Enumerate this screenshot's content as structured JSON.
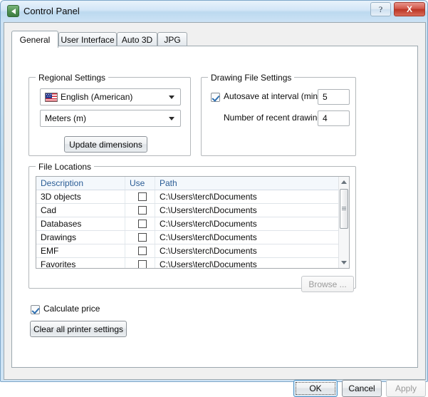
{
  "window": {
    "title": "Control Panel",
    "icon": "back-arrow-icon",
    "help_label": "?",
    "close_label": "X"
  },
  "tabs": [
    {
      "label": "General",
      "active": true
    },
    {
      "label": "User Interface",
      "active": false
    },
    {
      "label": "Auto 3D",
      "active": false
    },
    {
      "label": "JPG",
      "active": false
    }
  ],
  "regional_settings": {
    "group_title": "Regional Settings",
    "language_value": "English (American)",
    "language_flag": "us-flag-icon",
    "units_value": "Meters (m)",
    "update_button_label": "Update dimensions"
  },
  "drawing_file_settings": {
    "group_title": "Drawing File Settings",
    "autosave_label": "Autosave at interval (min)",
    "autosave_checked": true,
    "autosave_value": "5",
    "recent_drawings_label": "Number of recent drawings",
    "recent_drawings_value": "4"
  },
  "file_locations": {
    "group_title": "File Locations",
    "columns": [
      "Description",
      "Use",
      "Path"
    ],
    "rows": [
      {
        "description": "3D objects",
        "use": false,
        "path": "C:\\Users\\tercl\\Documents"
      },
      {
        "description": "Cad",
        "use": false,
        "path": "C:\\Users\\tercl\\Documents"
      },
      {
        "description": "Databases",
        "use": false,
        "path": "C:\\Users\\tercl\\Documents"
      },
      {
        "description": "Drawings",
        "use": false,
        "path": "C:\\Users\\tercl\\Documents"
      },
      {
        "description": "EMF",
        "use": false,
        "path": "C:\\Users\\tercl\\Documents"
      },
      {
        "description": "Favorites",
        "use": false,
        "path": "C:\\Users\\tercl\\Documents"
      }
    ],
    "browse_label": "Browse ...",
    "browse_disabled": true
  },
  "options": {
    "calculate_price_label": "Calculate price",
    "calculate_price_checked": true,
    "clear_printer_label": "Clear all printer settings"
  },
  "footer": {
    "ok_label": "OK",
    "cancel_label": "Cancel",
    "apply_label": "Apply",
    "apply_disabled": true
  },
  "colors": {
    "titlebar_accent": "#bcd9ef",
    "close_button": "#bb3626",
    "table_header_text": "#2b5d96",
    "default_button_border": "#4a90c4",
    "checkbox_check": "#2e6fb0"
  }
}
